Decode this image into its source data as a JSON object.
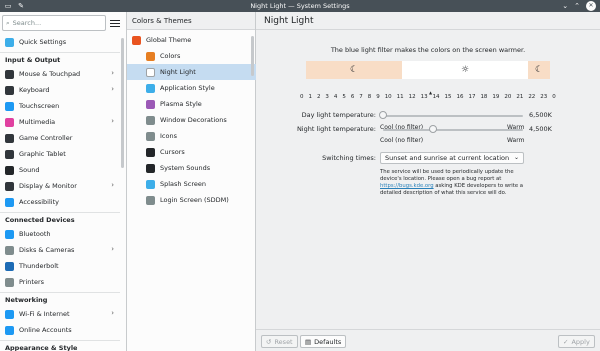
{
  "window": {
    "title": "Night Light — System Settings"
  },
  "search": {
    "placeholder": "Search..."
  },
  "sidebar": {
    "sections": [
      {
        "label": "",
        "items": [
          {
            "label": "Quick Settings",
            "icon": "quick-settings-icon",
            "color": "#3daee9",
            "chevron": false
          }
        ]
      },
      {
        "label": "Input & Output",
        "items": [
          {
            "label": "Mouse & Touchpad",
            "icon": "mouse-icon",
            "color": "#31363b",
            "chevron": true
          },
          {
            "label": "Keyboard",
            "icon": "keyboard-icon",
            "color": "#31363b",
            "chevron": true
          },
          {
            "label": "Touchscreen",
            "icon": "touchscreen-icon",
            "color": "#1d99f3",
            "chevron": false
          },
          {
            "label": "Multimedia",
            "icon": "multimedia-icon",
            "color": "#e040a0",
            "chevron": true
          },
          {
            "label": "Game Controller",
            "icon": "game-controller-icon",
            "color": "#31363b",
            "chevron": false
          },
          {
            "label": "Graphic Tablet",
            "icon": "tablet-icon",
            "color": "#31363b",
            "chevron": false
          },
          {
            "label": "Sound",
            "icon": "sound-icon",
            "color": "#232629",
            "chevron": false
          },
          {
            "label": "Display & Monitor",
            "icon": "display-icon",
            "color": "#31363b",
            "chevron": true
          },
          {
            "label": "Accessibility",
            "icon": "accessibility-icon",
            "color": "#1d99f3",
            "chevron": false
          }
        ]
      },
      {
        "label": "Connected Devices",
        "items": [
          {
            "label": "Bluetooth",
            "icon": "bluetooth-icon",
            "color": "#1d99f3",
            "chevron": false
          },
          {
            "label": "Disks & Cameras",
            "icon": "disks-icon",
            "color": "#7f8c8d",
            "chevron": true
          },
          {
            "label": "Thunderbolt",
            "icon": "thunderbolt-icon",
            "color": "#1d6bb5",
            "chevron": false
          },
          {
            "label": "Printers",
            "icon": "printer-icon",
            "color": "#7f8c8d",
            "chevron": false
          }
        ]
      },
      {
        "label": "Networking",
        "items": [
          {
            "label": "Wi-Fi & Internet",
            "icon": "wifi-icon",
            "color": "#1d99f3",
            "chevron": true
          },
          {
            "label": "Online Accounts",
            "icon": "online-accounts-icon",
            "color": "#1d99f3",
            "chevron": false
          }
        ]
      },
      {
        "label": "Appearance & Style",
        "items": []
      }
    ]
  },
  "middle": {
    "header": "Colors & Themes",
    "items": [
      {
        "label": "Global Theme",
        "icon": "global-theme-icon",
        "color": "#e95420",
        "sub": false,
        "active": false
      },
      {
        "label": "Colors",
        "icon": "colors-icon",
        "color": "#e67e22",
        "sub": true,
        "active": false
      },
      {
        "label": "Night Light",
        "icon": "night-light-icon",
        "color": "#ffffff",
        "sub": true,
        "active": true
      },
      {
        "label": "Application Style",
        "icon": "app-style-icon",
        "color": "#3daee9",
        "sub": true,
        "active": false
      },
      {
        "label": "Plasma Style",
        "icon": "plasma-style-icon",
        "color": "#9b59b6",
        "sub": true,
        "active": false
      },
      {
        "label": "Window Decorations",
        "icon": "window-decorations-icon",
        "color": "#7f8c8d",
        "sub": true,
        "active": false
      },
      {
        "label": "Icons",
        "icon": "icons-icon",
        "color": "#7f8c8d",
        "sub": true,
        "active": false
      },
      {
        "label": "Cursors",
        "icon": "cursors-icon",
        "color": "#232629",
        "sub": true,
        "active": false
      },
      {
        "label": "System Sounds",
        "icon": "system-sounds-icon",
        "color": "#232629",
        "sub": true,
        "active": false
      },
      {
        "label": "Splash Screen",
        "icon": "splash-screen-icon",
        "color": "#3daee9",
        "sub": true,
        "active": false
      },
      {
        "label": "Login Screen (SDDM)",
        "icon": "login-screen-icon",
        "color": "#7f8c8d",
        "sub": true,
        "active": false
      }
    ]
  },
  "main": {
    "title": "Night Light",
    "description": "The blue light filter makes the colors on the screen warmer.",
    "hours": [
      "0",
      "1",
      "2",
      "3",
      "4",
      "5",
      "6",
      "7",
      "8",
      "9",
      "10",
      "11",
      "12",
      "13",
      "14",
      "15",
      "16",
      "17",
      "18",
      "19",
      "20",
      "21",
      "22",
      "23",
      "0"
    ],
    "day_temp": {
      "label": "Day light temperature:",
      "value": "6,500K",
      "level": 0.0,
      "min_label": "Cool (no filter)",
      "max_label": "Warm"
    },
    "night_temp": {
      "label": "Night light temperature:",
      "value": "4,500K",
      "level": 0.36,
      "min_label": "Cool (no filter)",
      "max_label": "Warm"
    },
    "switching": {
      "label": "Switching times:",
      "value": "Sunset and sunrise at current location"
    },
    "note_before": "The service will be used to periodically update the device's location. Please open a bug report at ",
    "note_link": "https://bugs.kde.org",
    "note_after": " asking KDE developers to write a detailed description of what this service will do.",
    "buttons": {
      "reset": "Reset",
      "defaults": "Defaults",
      "apply": "Apply"
    }
  },
  "colors": {
    "accent": "#3daee9",
    "selection": "#c5dcf1",
    "night_band": "#f8ddc6",
    "titlebar": "#475057"
  }
}
